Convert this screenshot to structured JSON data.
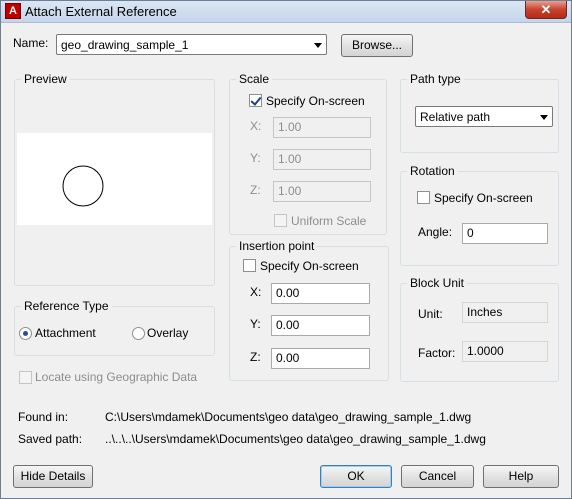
{
  "window": {
    "title": "Attach External Reference",
    "close_glyph": "✕",
    "app_icon_letter": "A"
  },
  "name_field": {
    "label": "Name:",
    "value": "geo_drawing_sample_1",
    "browse_label": "Browse..."
  },
  "preview": {
    "title": "Preview"
  },
  "scale": {
    "title": "Scale",
    "specify_label": "Specify On-screen",
    "x_label": "X:",
    "x_value": "1.00",
    "y_label": "Y:",
    "y_value": "1.00",
    "z_label": "Z:",
    "z_value": "1.00",
    "uniform_label": "Uniform Scale"
  },
  "insertion": {
    "title": "Insertion point",
    "specify_label": "Specify On-screen",
    "x_label": "X:",
    "x_value": "0.00",
    "y_label": "Y:",
    "y_value": "0.00",
    "z_label": "Z:",
    "z_value": "0.00"
  },
  "path_type": {
    "title": "Path type",
    "value": "Relative path"
  },
  "rotation": {
    "title": "Rotation",
    "specify_label": "Specify On-screen",
    "angle_label": "Angle:",
    "angle_value": "0"
  },
  "block_unit": {
    "title": "Block Unit",
    "unit_label": "Unit:",
    "unit_value": "Inches",
    "factor_label": "Factor:",
    "factor_value": "1.0000"
  },
  "reference_type": {
    "title": "Reference Type",
    "attachment_label": "Attachment",
    "overlay_label": "Overlay"
  },
  "geo_label": "Locate using Geographic Data",
  "found_in": {
    "label": "Found in:",
    "value": "C:\\Users\\mdamek\\Documents\\geo data\\geo_drawing_sample_1.dwg"
  },
  "saved_path": {
    "label": "Saved path:",
    "value": "..\\..\\..\\Users\\mdamek\\Documents\\geo data\\geo_drawing_sample_1.dwg"
  },
  "buttons": {
    "hide_details": "Hide Details",
    "ok": "OK",
    "cancel": "Cancel",
    "help": "Help"
  }
}
